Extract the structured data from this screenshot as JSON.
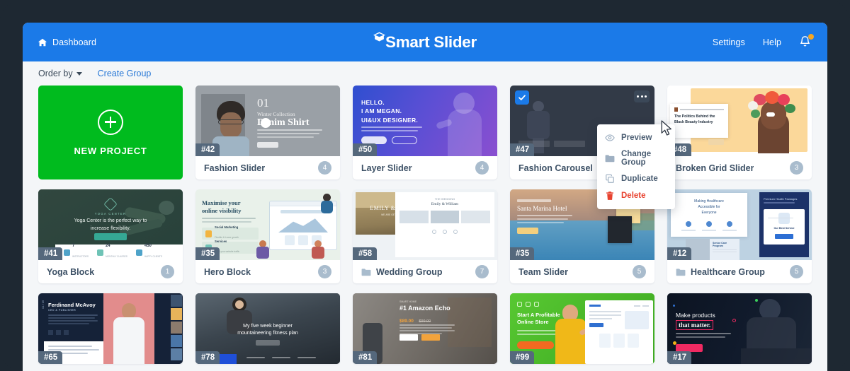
{
  "header": {
    "dashboard_label": "Dashboard",
    "home_icon": "home-icon",
    "logo_text": "Smart Slider",
    "logo_icon": "graduation-cap-icon",
    "settings_label": "Settings",
    "help_label": "Help",
    "bell_icon": "notification-bell-icon",
    "bg_color": "#1b7ae8"
  },
  "toolbar": {
    "order_by_label": "Order by",
    "order_by_icon": "chevron-down-icon",
    "create_group_label": "Create Group",
    "create_group_color": "#2878d6"
  },
  "new_project": {
    "label": "NEW PROJECT",
    "icon": "plus-circle-icon",
    "bg_color": "#00bb1e"
  },
  "context_menu": {
    "visible": true,
    "items": [
      {
        "label": "Preview",
        "icon": "eye-icon",
        "danger": false
      },
      {
        "label": "Change Group",
        "icon": "folder-icon",
        "danger": false
      },
      {
        "label": "Duplicate",
        "icon": "copy-icon",
        "danger": false
      },
      {
        "label": "Delete",
        "icon": "trash-icon",
        "danger": true
      }
    ],
    "danger_color": "#e8422f"
  },
  "cursor": {
    "icon": "mouse-pointer-icon"
  },
  "cards": [
    {
      "id": "#42",
      "title": "Fashion Slider",
      "count": "4",
      "is_group": false,
      "selected": false,
      "art": "fashion"
    },
    {
      "id": "#50",
      "title": "Layer Slider",
      "count": "4",
      "is_group": false,
      "selected": false,
      "art": "layer"
    },
    {
      "id": "#47",
      "title": "Fashion Carousel",
      "count": "",
      "is_group": false,
      "selected": true,
      "art": "carousel"
    },
    {
      "id": "#48",
      "title": "Broken Grid Slider",
      "count": "3",
      "is_group": false,
      "selected": false,
      "art": "brokengrid"
    },
    {
      "id": "#41",
      "title": "Yoga Block",
      "count": "1",
      "is_group": false,
      "selected": false,
      "art": "yoga"
    },
    {
      "id": "#35",
      "title": "Hero Block",
      "count": "3",
      "is_group": false,
      "selected": false,
      "art": "hero"
    },
    {
      "id": "#58",
      "title": "Wedding Group",
      "count": "7",
      "is_group": true,
      "selected": false,
      "art": "wedding"
    },
    {
      "id": "#35",
      "title": "Team Slider",
      "count": "5",
      "is_group": false,
      "selected": false,
      "art": "team"
    },
    {
      "id": "#12",
      "title": "Healthcare Group",
      "count": "5",
      "is_group": true,
      "selected": false,
      "art": "healthcare"
    },
    {
      "id": "#65",
      "title": "",
      "count": "",
      "is_group": false,
      "selected": false,
      "art": "ferdinand"
    },
    {
      "id": "#78",
      "title": "",
      "count": "",
      "is_group": false,
      "selected": false,
      "art": "fitness"
    },
    {
      "id": "#81",
      "title": "",
      "count": "",
      "is_group": false,
      "selected": false,
      "art": "amazon"
    },
    {
      "id": "#99",
      "title": "",
      "count": "",
      "is_group": false,
      "selected": false,
      "art": "store"
    },
    {
      "id": "#17",
      "title": "",
      "count": "",
      "is_group": false,
      "selected": false,
      "art": "products"
    }
  ],
  "thumb_text": {
    "fashion": {
      "num": "01",
      "kicker": "Winter Collection",
      "title": "Denim Shirt"
    },
    "layer": {
      "l1": "HELLO.",
      "l2": "I AM MEGAN.",
      "l3": "UI&UX DESIGNER."
    },
    "brokengrid": {
      "t1": "The Politics Behind the",
      "t2": "Black Beauty Industry"
    },
    "yoga": {
      "t1": "Yoga Center is the perfect way to",
      "t2": "increase flexibility.",
      "s1": "7",
      "s2": "24",
      "s3": "450"
    },
    "hero": {
      "t1": "Maximise your",
      "t2": "online visibility"
    },
    "wedding": {
      "title": "EMILY & WILLIAM"
    },
    "team": {
      "title": "Santa Marina Hotel"
    },
    "healthcare": {
      "t1": "Making Healthcare",
      "t2": "Accessible for",
      "t3": "Everyone"
    },
    "ferdinand": {
      "name": "Ferdinand McAvoy",
      "role": "CEO & PUBLISHER",
      "idx": "01 / 06"
    },
    "fitness": {
      "t1": "My five week beginner",
      "t2": "mountaineering fitness plan"
    },
    "amazon": {
      "title": "#1 Amazon Echo",
      "price": "$89.00",
      "old": "$99.00"
    },
    "store": {
      "t1": "Start A Profitable",
      "t2": "Online Store"
    },
    "products": {
      "t1": "Make products",
      "t2": "that matter."
    }
  }
}
